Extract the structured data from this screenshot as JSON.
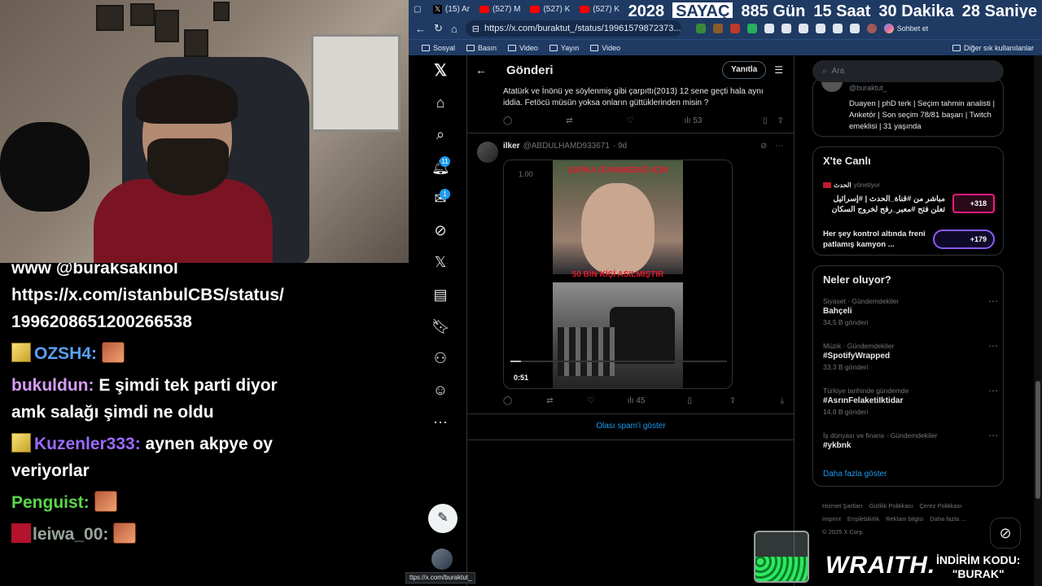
{
  "stream": {
    "chat": [
      {
        "type": "text",
        "text": "www @buraksakinol"
      },
      {
        "type": "text",
        "text": "https://x.com/istanbulCBS/status/"
      },
      {
        "type": "text",
        "text": "1996208651200266538"
      },
      {
        "type": "msg",
        "user": "OZSH4:",
        "user_color": "#5aa0f5",
        "message": "",
        "emote": true,
        "badge": "gold"
      },
      {
        "type": "msg",
        "user": "bukuldun:",
        "user_color": "#d79cf5",
        "message": "E şimdi tek parti diyor",
        "emote": false,
        "badge": ""
      },
      {
        "type": "text",
        "text": "amk salağı şimdi ne oldu"
      },
      {
        "type": "msg",
        "user": "Kuzenler333:",
        "user_color": "#9b6bff",
        "message": "aynen akpye oy",
        "emote": false,
        "badge": "gold"
      },
      {
        "type": "text",
        "text": "veriyorlar"
      },
      {
        "type": "msg",
        "user": "Penguist:",
        "user_color": "#59d64b",
        "message": "",
        "emote": true,
        "badge": ""
      },
      {
        "type": "msg",
        "user": "leiwa_00:",
        "user_color": "#9aa59a",
        "message": "",
        "emote": true,
        "badge": "red"
      }
    ],
    "sponsor_brand": "WRAITH.",
    "promo_line1": "İNDİRİM KODU:",
    "promo_line2": "\"BURAK\""
  },
  "browser": {
    "tabs": [
      {
        "icon": "x",
        "label": "(15) Ar"
      },
      {
        "icon": "youtube",
        "label": "(527) M"
      },
      {
        "icon": "youtube",
        "label": "(527) K"
      },
      {
        "icon": "youtube",
        "label": "(527) K"
      }
    ],
    "counter": {
      "year": "2028",
      "label": "SAYAÇ",
      "days": "885 Gün",
      "hours": "15 Saat",
      "minutes": "30 Dakika",
      "seconds": "28 Saniye"
    },
    "url": "https://x.com/buraktut_/status/19961579872373...",
    "chat_label": "Sohbet et",
    "bookmarks": [
      "Sosyal",
      "Basın",
      "Video",
      "Yayın",
      "Video"
    ],
    "bookmarks_other": "Diğer sık kullanılanlar",
    "status_url": "ttps://x.com/buraktut_"
  },
  "x": {
    "nav_badges": {
      "notifications": "11",
      "messages": "1"
    },
    "header": {
      "title": "Gönderi",
      "reply_button": "Yanıtla"
    },
    "prev_tweet": {
      "text_line1": "Atatürk ve İnönü ye söylenmiş gibi çarpıttı(2013) 12 sene geçti hala aynı",
      "text_line2": "iddia. Fetöcü müsün yoksa onların güttüklerinden misin ?",
      "views": "53"
    },
    "tweet": {
      "name": "ilker",
      "handle": "@ABDULHAMD933671",
      "time": "· 9d",
      "video_caption_top": "ŞAPKA GIYINMEDIĞI İÇİN",
      "video_caption_mid": "50 BİN KİŞİ ASILMIŞTIR",
      "video_time": "0:51",
      "video_counter": "1.00",
      "progress": 0.05,
      "views": "45"
    },
    "spam_link": "Olası spam'i göster",
    "search_placeholder": "Ara",
    "profile": {
      "handle": "@buraktut_",
      "bio": "Duayen | phD terk | Seçim tahmin analisti | Anketör | Son seçim 78/81 başarı | Twitch emeklisi | 31 yaşında"
    },
    "live": {
      "title": "X'te Canlı",
      "items": [
        {
          "host": "الحدث",
          "status": "yönetiyor",
          "text": "مباشر من #قناة_الحدث | #إسرائيل تعلن فتح #معبر_رفح لخروج السكان",
          "count": "+318"
        },
        {
          "host": "",
          "status": "",
          "text": "Her şey kontrol altında freni patlamış kamyon ...",
          "count": "+179"
        }
      ]
    },
    "trends": {
      "title": "Neler oluyor?",
      "items": [
        {
          "category": "Siyaset · Gündemdekiler",
          "name": "Bahçeli",
          "count": "34,5 B gönderi"
        },
        {
          "category": "Müzik · Gündemdekiler",
          "name": "#SpotifyWrapped",
          "count": "33,3 B gönderi"
        },
        {
          "category": "Türkiye tarihinde gündemde",
          "name": "#AsrınFelaketiIktidar",
          "count": "14,8 B gönderi"
        },
        {
          "category": "İş dünyası ve finans · Gündemdekiler",
          "name": "#ykbnk",
          "count": ""
        }
      ],
      "show_more": "Daha fazla göster"
    },
    "footer": [
      "Hizmet Şartları",
      "Gizlilik Politikası",
      "Çerez Politikası",
      "Imprint",
      "Erişilebilirlik",
      "Reklam bilgisi",
      "Daha fazla ...",
      "© 2025 X Corp."
    ]
  }
}
